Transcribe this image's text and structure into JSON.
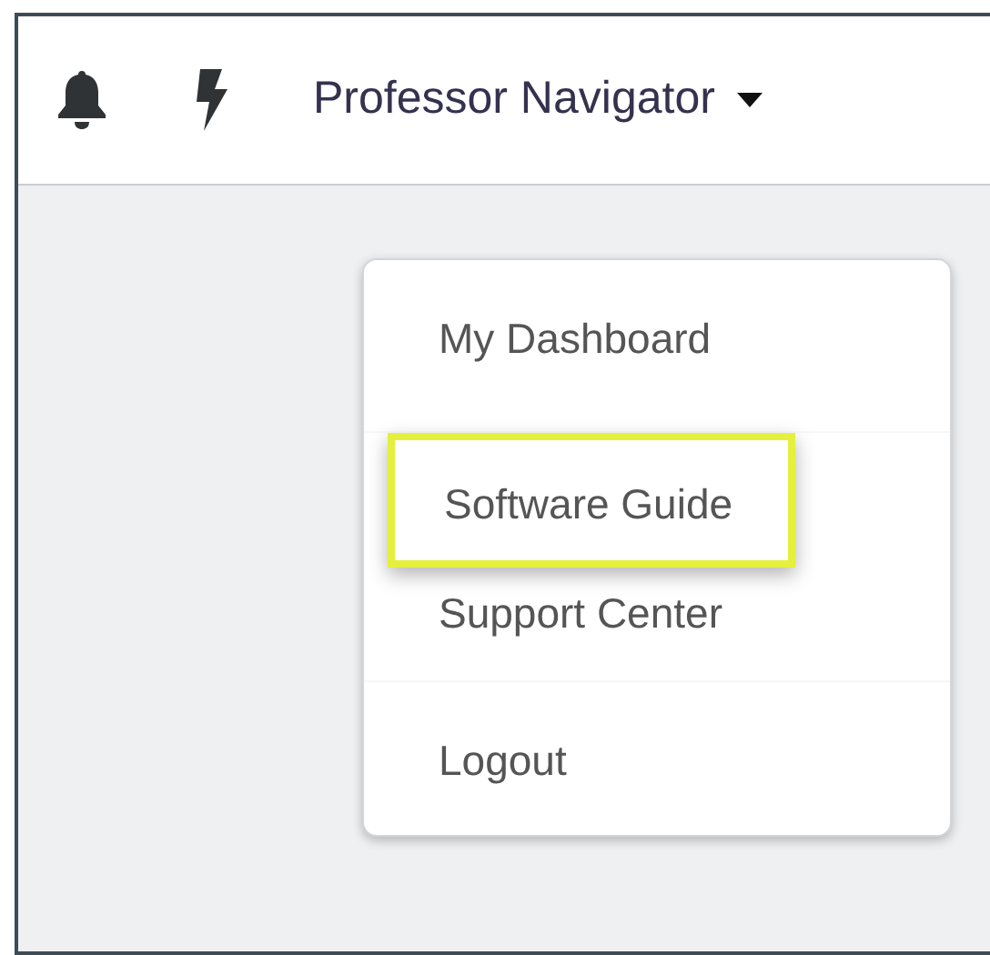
{
  "header": {
    "user_name": "Professor Navigator"
  },
  "menu": [
    {
      "kind": "item",
      "label": "My Dashboard",
      "highlighted": false
    },
    {
      "kind": "divider"
    },
    {
      "kind": "item",
      "label": "Software Guide",
      "highlighted": true
    },
    {
      "kind": "item",
      "label": "Support Center",
      "highlighted": false
    },
    {
      "kind": "divider"
    },
    {
      "kind": "item",
      "label": "Logout",
      "highlighted": false
    }
  ]
}
